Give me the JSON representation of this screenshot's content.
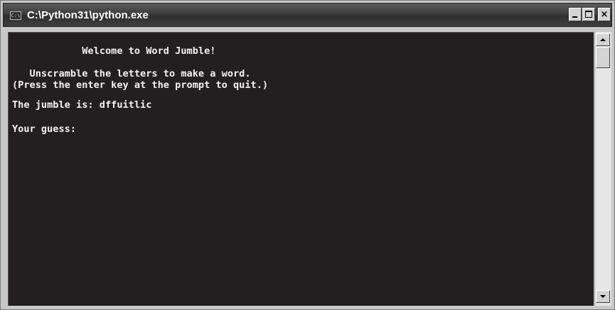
{
  "window": {
    "title": "C:\\Python31\\python.exe",
    "icon_label": "C:\\",
    "controls": {
      "minimize": "minimize-icon",
      "maximize": "maximize-icon",
      "close": "close-icon",
      "close_label": "×"
    }
  },
  "console": {
    "lines": [
      "            Welcome to Word Jumble!",
      "   Unscramble the letters to make a word.",
      "(Press the enter key at the prompt to quit.)",
      "The jumble is: dffuitlic",
      "Your guess:"
    ],
    "colors": {
      "background": "#231f20",
      "text": "#f2f2f2"
    }
  }
}
